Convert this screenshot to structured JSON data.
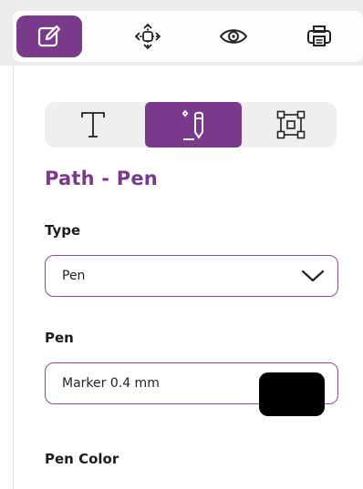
{
  "toolbar": {
    "buttons": [
      {
        "icon": "edit-icon",
        "active": true
      },
      {
        "icon": "move-icon",
        "active": false
      },
      {
        "icon": "eye-icon",
        "active": false
      },
      {
        "icon": "print-icon",
        "active": false
      }
    ]
  },
  "tool_tabs": [
    {
      "icon": "text-tool-icon",
      "active": false
    },
    {
      "icon": "pen-tool-icon",
      "active": true
    },
    {
      "icon": "frame-tool-icon",
      "active": false
    }
  ],
  "panel": {
    "title": "Path - Pen",
    "type": {
      "label": "Type",
      "value": "Pen"
    },
    "pen": {
      "label": "Pen",
      "value": "Marker 0.4 mm"
    },
    "pen_color": {
      "label": "Pen Color",
      "value": "#000000"
    }
  },
  "colors": {
    "accent": "#7a3a8c",
    "border": "#8d4a9f"
  }
}
